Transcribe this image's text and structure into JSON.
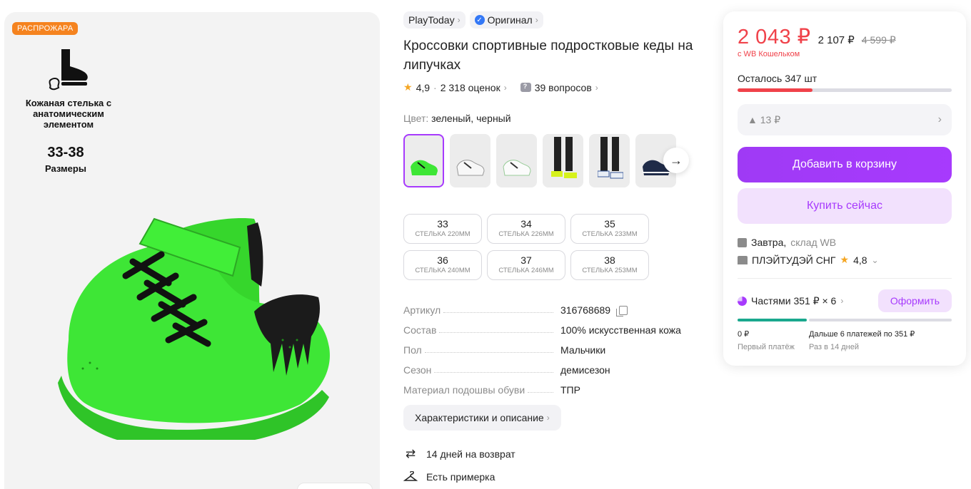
{
  "gallery": {
    "sale_badge": "РАСПРОЖАРА",
    "feature_text": "Кожаная стелька с анатомическим элементом",
    "sizes_range": "33-38",
    "sizes_label": "Размеры"
  },
  "brand": {
    "name": "PlayToday",
    "original_label": "Оригинал"
  },
  "product": {
    "title": "Кроссовки спортивные подростковые кеды на липучках",
    "rating": "4,9",
    "reviews": "2 318 оценок",
    "questions": "39 вопросов"
  },
  "color": {
    "label": "Цвет:",
    "value": "зеленый, черный"
  },
  "sizes": [
    {
      "size": "33",
      "insole": "СТЕЛЬКА 220ММ"
    },
    {
      "size": "34",
      "insole": "СТЕЛЬКА 226ММ"
    },
    {
      "size": "35",
      "insole": "СТЕЛЬКА 233ММ"
    },
    {
      "size": "36",
      "insole": "СТЕЛЬКА 240ММ"
    },
    {
      "size": "37",
      "insole": "СТЕЛЬКА 246ММ"
    },
    {
      "size": "38",
      "insole": "СТЕЛЬКА 253ММ"
    }
  ],
  "specs": [
    {
      "key": "Артикул",
      "value": "316768689"
    },
    {
      "key": "Состав",
      "value": "100% искусственная кожа"
    },
    {
      "key": "Пол",
      "value": "Мальчики"
    },
    {
      "key": "Сезон",
      "value": "демисезон"
    },
    {
      "key": "Материал подошвы обуви",
      "value": "ТПР"
    }
  ],
  "description_button": "Характеристики и описание",
  "perks": {
    "return": "14 дней на возврат",
    "fitting": "Есть примерка"
  },
  "price_card": {
    "price": "2 043 ₽",
    "price_mid": "2 107 ₽",
    "price_old": "4 599 ₽",
    "wallet_note": "с WB Кошельком",
    "stock": "Осталось 347 шт",
    "stock_fill_fraction": 0.35,
    "price_delta": "▲ 13 ₽",
    "add_to_cart": "Добавить в корзину",
    "buy_now": "Купить сейчас",
    "delivery_day": "Завтра,",
    "warehouse": "склад WB",
    "seller_name": "ПЛЭЙТУДЭЙ СНГ",
    "seller_rating": "4,8",
    "installments_label": "Частями 351 ₽ × 6",
    "arrange_button": "Оформить",
    "first_payment_value": "0 ₽",
    "first_payment_label": "Первый платёж",
    "next_payments_value": "Дальше 6 платежей по 351 ₽",
    "next_payments_label": "Раз в 14 дней"
  },
  "colors": {
    "accent": "#a73afd",
    "price": "#f0424a",
    "sale": "#f5831f",
    "progress_green": "#1aa88e"
  }
}
